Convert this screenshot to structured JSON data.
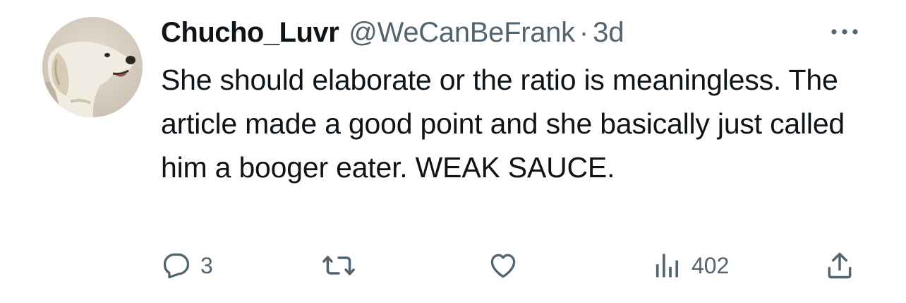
{
  "author": {
    "display_name": "Chucho_Luvr",
    "handle": "@WeCanBeFrank",
    "separator": "·",
    "time_ago": "3d"
  },
  "tweet": {
    "text": "She should elaborate or the ratio is meaningless. The article made a good point and she basically just called him a booger eater. WEAK SAUCE."
  },
  "actions": {
    "reply_count": "3",
    "retweet_count": "",
    "like_count": "",
    "views_count": "402"
  },
  "icons": {
    "more": "more-horizontal-icon",
    "reply": "reply-bubble-icon",
    "retweet": "retweet-icon",
    "like": "heart-icon",
    "views": "views-bar-chart-icon",
    "share": "share-upload-icon"
  },
  "colors": {
    "text_primary": "#0f1419",
    "text_secondary": "#536471",
    "background": "#ffffff"
  }
}
